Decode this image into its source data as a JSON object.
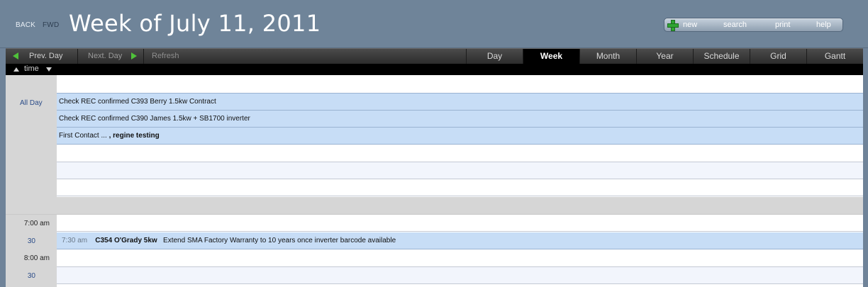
{
  "header": {
    "back_label": "BACK",
    "fwd_label": "FWD",
    "title": "Week of July 11, 2011",
    "toolbar": {
      "new_label": "new",
      "search_label": "search",
      "print_label": "print",
      "help_label": "help"
    }
  },
  "navbar": {
    "prev_day_label": "Prev. Day",
    "next_day_label": "Next. Day",
    "refresh_label": "Refresh",
    "views": [
      {
        "label": "Day",
        "active": false
      },
      {
        "label": "Week",
        "active": true
      },
      {
        "label": "Month",
        "active": false
      },
      {
        "label": "Year",
        "active": false
      },
      {
        "label": "Schedule",
        "active": false
      },
      {
        "label": "Grid",
        "active": false
      },
      {
        "label": "Gantt",
        "active": false
      }
    ]
  },
  "sortbar": {
    "label": "time"
  },
  "all_day": {
    "label": "All Day",
    "events": [
      {
        "text": "Check REC confirmed C393 Berry 1.5kw Contract"
      },
      {
        "text": "Check REC confirmed C390 James 1.5kw + SB1700 inverter"
      },
      {
        "text_normal": "First Contact  ... ",
        "text_bold": ", regine testing"
      }
    ]
  },
  "times": {
    "t700": "7:00 am",
    "t730": "30",
    "t800": "8:00 am",
    "t830": "30"
  },
  "timed_event": {
    "time": "7:30 am",
    "title": "C354 O'Grady 5kw",
    "description": "Extend SMA Factory Warranty to 10 years once inverter barcode available"
  },
  "colors": {
    "header_bg": "#6f8499",
    "event_blue": "#c7ddf6",
    "nav_dark": "#2c2c2c",
    "accent_green": "#4fc23a"
  }
}
